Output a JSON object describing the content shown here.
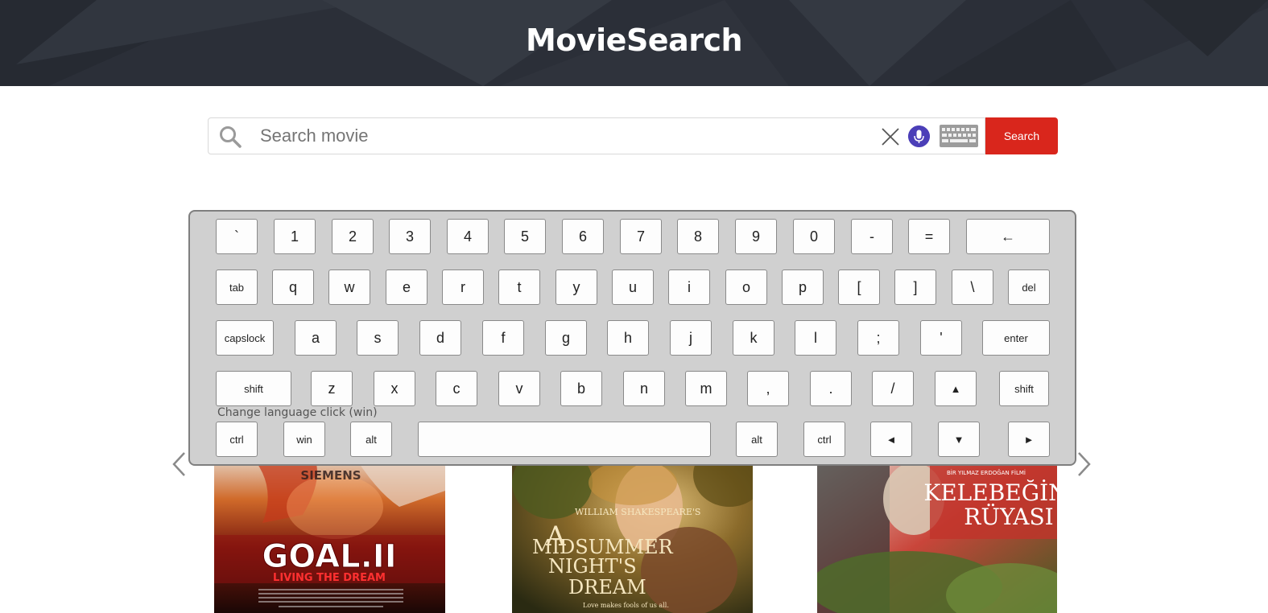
{
  "header": {
    "title": "MovieSearch"
  },
  "search": {
    "placeholder": "Search movie",
    "value": "",
    "button_label": "Search",
    "icons": [
      "search-icon",
      "close-icon",
      "microphone-icon",
      "keyboard-icon"
    ]
  },
  "keyboard": {
    "note": "Change language click (win)",
    "rows": [
      [
        "`",
        "1",
        "2",
        "3",
        "4",
        "5",
        "6",
        "7",
        "8",
        "9",
        "0",
        "-",
        "=",
        "←"
      ],
      [
        "tab",
        "q",
        "w",
        "e",
        "r",
        "t",
        "y",
        "u",
        "i",
        "o",
        "p",
        "[",
        "]",
        "\\",
        "del"
      ],
      [
        "capslock",
        "a",
        "s",
        "d",
        "f",
        "g",
        "h",
        "j",
        "k",
        "l",
        ";",
        "'",
        "enter"
      ],
      [
        "shift",
        "z",
        "x",
        "c",
        "v",
        "b",
        "n",
        "m",
        ",",
        ".",
        "/",
        "▲",
        "shift"
      ],
      [
        "ctrl",
        "win",
        "alt",
        "",
        "alt",
        "ctrl",
        "◄",
        "▼",
        "►"
      ]
    ]
  },
  "carousel": {
    "posters": [
      {
        "title_line1": "GOAL.II",
        "title_line2": "LIVING THE DREAM",
        "sponsor": "SIEMENS"
      },
      {
        "title_line1": "A",
        "title_line2": "WILLIAM SHAKESPEARE'S",
        "title_line3": "MIDSUMMER",
        "title_line4": "NIGHT'S",
        "title_line5": "DREAM",
        "tagline": "Love makes fools of us all."
      },
      {
        "title_line1": "KELEBEĞİN",
        "title_line2": "RÜYASI",
        "credit": "BİR YILMAZ ERDOĞAN FİLMİ"
      }
    ],
    "prev_icon": "chevron-left-icon",
    "next_icon": "chevron-right-icon"
  },
  "colors": {
    "header_bg": "#2b2f38",
    "accent": "#d9261c",
    "mic": "#4b3fb8",
    "keyboard_bg": "#d0d0d0"
  }
}
